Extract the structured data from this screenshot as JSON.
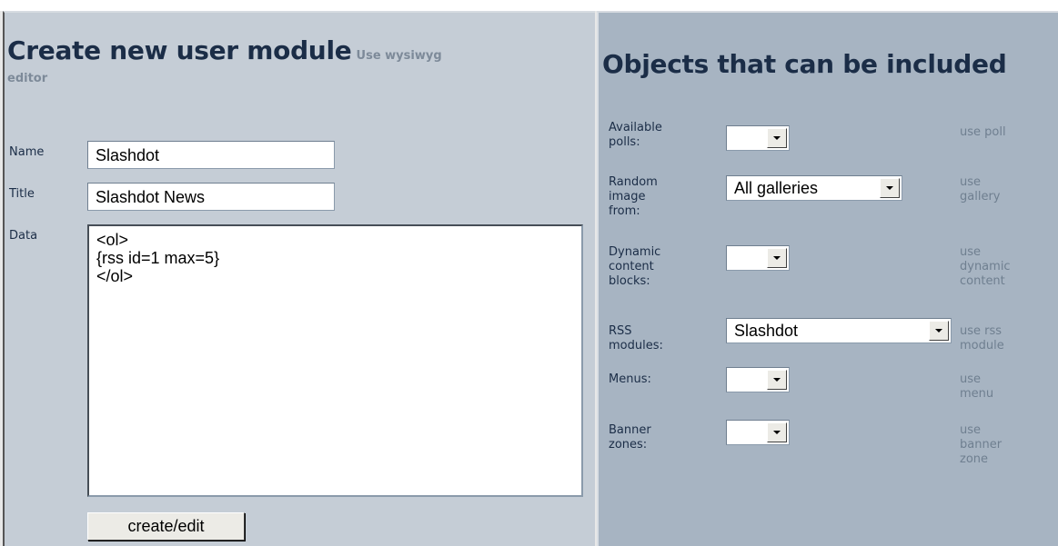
{
  "create": {
    "title": "Create new user module",
    "wysiwyg_link_part1": "Use wysiwyg",
    "wysiwyg_link_part2": "editor",
    "name_label": "Name",
    "name_value": "Slashdot",
    "title_label": "Title",
    "title_value": "Slashdot News",
    "data_label": "Data",
    "data_lines": [
      "<ol>",
      "{rss id=1 max=5}",
      "</ol>"
    ],
    "button": "create/edit"
  },
  "objects": {
    "title": "Objects that can be included",
    "rows": [
      {
        "label_lines": [
          "Available",
          "polls:"
        ],
        "selected": "",
        "use_lines": [
          "use poll"
        ]
      },
      {
        "label_lines": [
          "Random",
          "image",
          "from:"
        ],
        "selected": "All galleries",
        "use_lines": [
          "use",
          "gallery"
        ]
      },
      {
        "label_lines": [
          "Dynamic",
          "content",
          "blocks:"
        ],
        "selected": "",
        "use_lines": [
          "use",
          "dynamic",
          "content"
        ]
      },
      {
        "label_lines": [
          "RSS",
          "modules:"
        ],
        "selected": "Slashdot",
        "use_lines": [
          "use rss",
          "module"
        ]
      },
      {
        "label_lines": [
          "Menus:"
        ],
        "selected": "",
        "use_lines": [
          "use",
          "menu"
        ]
      },
      {
        "label_lines": [
          "Banner",
          "zones:"
        ],
        "selected": "",
        "use_lines": [
          "use",
          "banner",
          "zone"
        ]
      }
    ]
  },
  "colors": {
    "left_panel": "#c5cdd6",
    "right_panel": "#a7b4c2",
    "title": "#1b2d47",
    "link": "#6f7f90"
  }
}
